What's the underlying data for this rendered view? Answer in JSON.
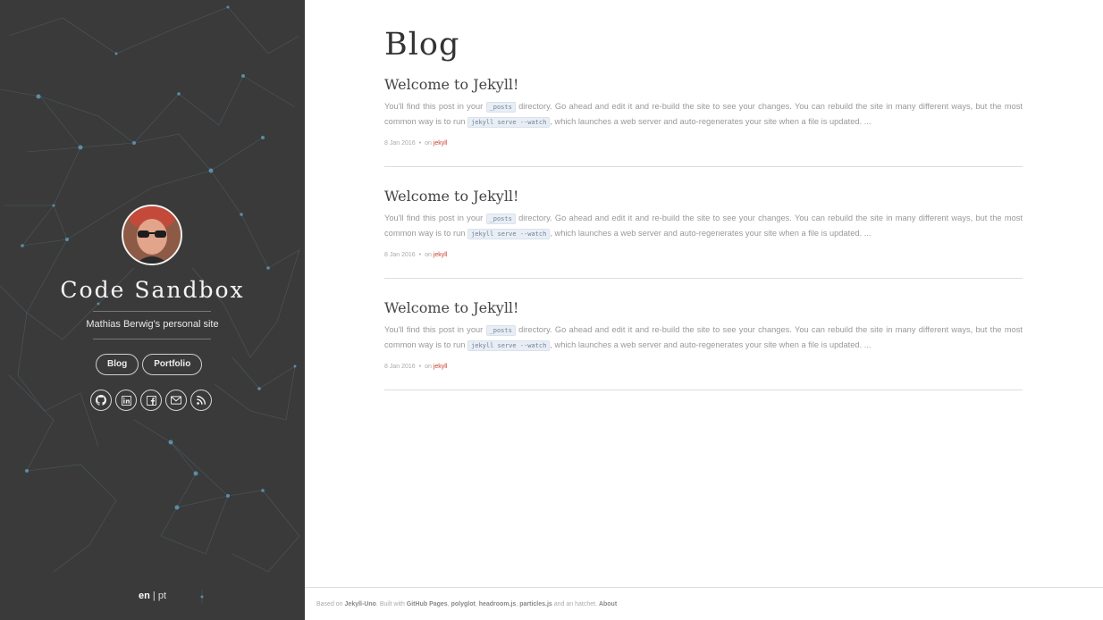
{
  "sidebar": {
    "site_title": "Code Sandbox",
    "tagline": "Mathias Berwig's personal site",
    "nav": [
      {
        "label": "Blog"
      },
      {
        "label": "Portfolio"
      }
    ],
    "socials": [
      {
        "icon": "github-icon"
      },
      {
        "icon": "linkedin-icon"
      },
      {
        "icon": "facebook-icon"
      },
      {
        "icon": "email-icon"
      },
      {
        "icon": "rss-icon"
      }
    ],
    "lang": {
      "active": "en",
      "separator": " | ",
      "other": "pt"
    },
    "colors": {
      "background": "#3a3a3a",
      "particles": "#5f8aa0"
    }
  },
  "main": {
    "page_title": "Blog",
    "posts": [
      {
        "title": "Welcome to Jekyll!",
        "excerpt_1": "You'll find this post in your ",
        "code_1": "_posts",
        "excerpt_2": " directory. Go ahead and edit it and re-build the site to see your changes. You can rebuild the site in many different ways, but the most common way is to run ",
        "code_2": "jekyll serve --watch",
        "excerpt_3": ", which launches a web server and auto-regenerates your site when a file is updated. ...",
        "date": "8 Jan 2016",
        "dot": "•",
        "on": "on ",
        "tag": "jekyll"
      },
      {
        "title": "Welcome to Jekyll!",
        "excerpt_1": "You'll find this post in your ",
        "code_1": "_posts",
        "excerpt_2": " directory. Go ahead and edit it and re-build the site to see your changes. You can rebuild the site in many different ways, but the most common way is to run ",
        "code_2": "jekyll serve --watch",
        "excerpt_3": ", which launches a web server and auto-regenerates your site when a file is updated. ...",
        "date": "8 Jan 2016",
        "dot": "•",
        "on": "on ",
        "tag": "jekyll"
      },
      {
        "title": "Welcome to Jekyll!",
        "excerpt_1": "You'll find this post in your ",
        "code_1": "_posts",
        "excerpt_2": " directory. Go ahead and edit it and re-build the site to see your changes. You can rebuild the site in many different ways, but the most common way is to run ",
        "code_2": "jekyll serve --watch",
        "excerpt_3": ", which launches a web server and auto-regenerates your site when a file is updated. ...",
        "date": "8 Jan 2016",
        "dot": "•",
        "on": "on ",
        "tag": "jekyll"
      }
    ]
  },
  "footer": {
    "based_on": "Based on ",
    "jekyll_uno": "Jekyll-Uno",
    "built_with": ". Built with ",
    "github_pages": "GitHub Pages",
    "sep1": ", ",
    "polyglot": "polyglot",
    "sep2": ", ",
    "headroom": "headroom.js",
    "sep3": ", ",
    "particles": "particles.js",
    "and": " and an hatchet. ",
    "about": "About"
  }
}
